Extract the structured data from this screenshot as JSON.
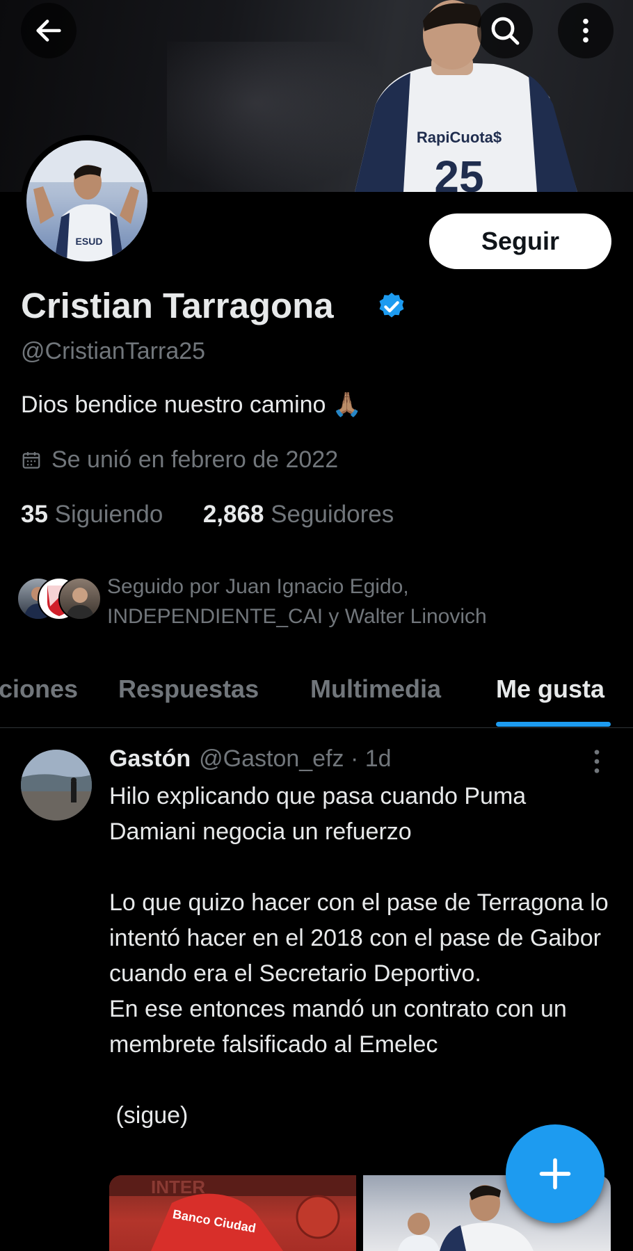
{
  "header": {
    "back_icon": "arrow-left-icon",
    "search_icon": "search-icon",
    "more_icon": "more-vertical-icon",
    "banner_sponsor": "RapiCuota$",
    "banner_number": "25"
  },
  "profile": {
    "follow_label": "Seguir",
    "name": "Cristian Tarragona",
    "verified_icon": "verified-badge-icon",
    "handle": "@CristianTarra25",
    "bio": "Dios bendice nuestro camino 🙏🏽",
    "joined_icon": "calendar-icon",
    "joined": "Se unió en febrero de 2022",
    "following_count": "35",
    "following_label": "Siguiendo",
    "followers_count": "2,868",
    "followers_label": "Seguidores",
    "followed_by": "Seguido por Juan Ignacio Egido, INDEPENDIENTE_CAI y Walter Linovich",
    "avatar_jersey_text": "ESUD"
  },
  "tabs": [
    {
      "label": "ciones",
      "active": false
    },
    {
      "label": "Respuestas",
      "active": false
    },
    {
      "label": "Multimedia",
      "active": false
    },
    {
      "label": "Me gusta",
      "active": true
    }
  ],
  "tweet": {
    "author": "Gastón",
    "handle": "@Gaston_efz",
    "time": "· 1d",
    "text": "Hilo explicando que pasa cuando Puma Damiani negocia un refuerzo\n\nLo que quizo hacer con el pase de Terragona lo intentó hacer en el 2018 con el pase de Gaibor cuando era el Secretario Deportivo.\nEn ese entonces mandó un contrato con un membrete falsificado al Emelec\n\n (sigue)",
    "more_icon": "more-vertical-icon",
    "media1_text": "Banco Ciudad",
    "media1_text2": "INTER"
  },
  "fab": {
    "icon": "plus-icon"
  },
  "colors": {
    "accent": "#1d9bf0",
    "background": "#000000",
    "text": "#e7e9ea",
    "muted": "#71767b"
  }
}
